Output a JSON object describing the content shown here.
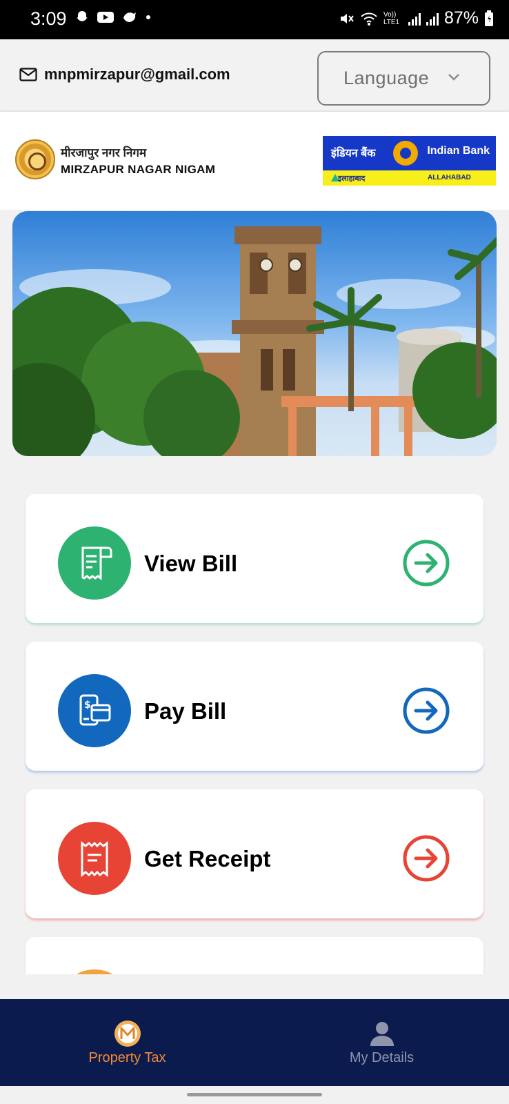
{
  "status_bar": {
    "time": "3:09",
    "battery": "87%",
    "network_label": "Vo)) LTE1"
  },
  "topbar": {
    "email": "mnpmirzapur@gmail.com",
    "language_label": "Language"
  },
  "header": {
    "org_hindi": "मीरजापुर नगर निगम",
    "org_english": "MIRZAPUR NAGAR NIGAM",
    "bank_hindi": "इंडियन बैंक",
    "bank_english": "Indian Bank",
    "bank_sub_hindi": "इलाहाबाद",
    "bank_sub_english": "ALLAHABAD"
  },
  "actions": [
    {
      "label": "View Bill",
      "color": "#2db272"
    },
    {
      "label": "Pay Bill",
      "color": "#1268bd"
    },
    {
      "label": "Get Receipt",
      "color": "#e74435"
    },
    {
      "label": "",
      "color": "#f2a23a"
    }
  ],
  "bottom_nav": {
    "items": [
      {
        "label": "Property Tax",
        "active": true
      },
      {
        "label": "My Details",
        "active": false
      }
    ],
    "active_color": "#f28a3a",
    "background": "#0c1b4d"
  }
}
